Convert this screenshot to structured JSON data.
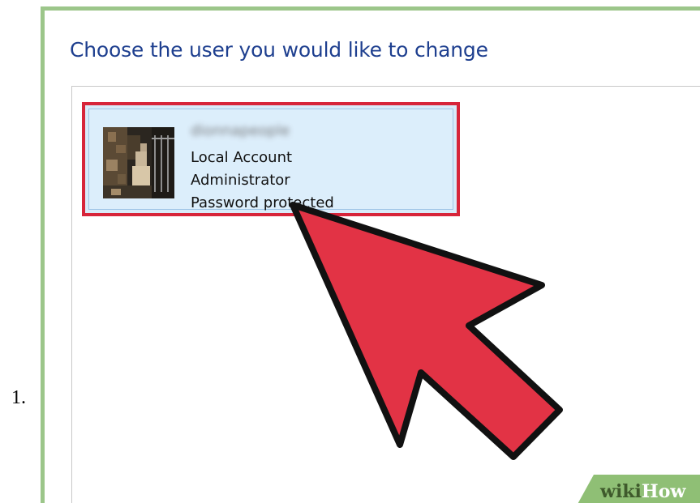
{
  "step": {
    "number": "1."
  },
  "window": {
    "title": "Choose the user you would like to change"
  },
  "user_tile": {
    "name": "dionnapeople",
    "account_type": "Local Account",
    "role": "Administrator",
    "security": "Password protected",
    "highlighted": true
  },
  "watermark": {
    "wiki": "wiki",
    "how": "How"
  },
  "colors": {
    "frame_border": "#9cc68a",
    "title_text": "#1e3f8f",
    "tile_background": "#dceefb",
    "highlight_border": "#d7253a",
    "arrow_fill": "#e23345"
  },
  "icons": {
    "avatar": "user-avatar-photo",
    "pointer": "pointer-arrow-icon"
  }
}
